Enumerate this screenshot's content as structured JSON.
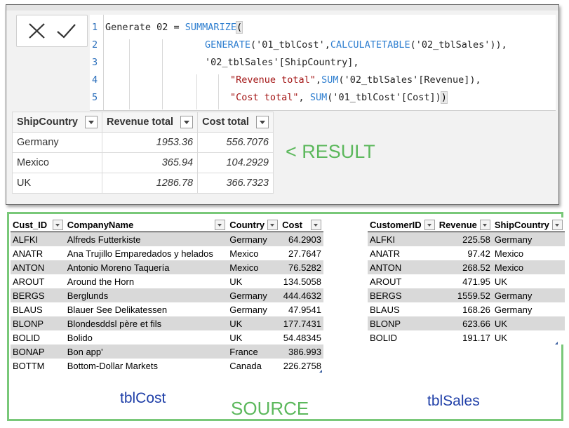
{
  "editor": {
    "cancel_icon": "close-icon",
    "commit_icon": "check-icon",
    "line_numbers": [
      "1",
      "2",
      "3",
      "4",
      "5"
    ],
    "code": [
      [
        {
          "t": "Generate 02 = ",
          "c": "txt"
        },
        {
          "t": "SUMMARIZE",
          "c": "kw"
        },
        {
          "t": "(",
          "c": "paren-hl"
        }
      ],
      [
        {
          "t": "GENERATE",
          "c": "kw"
        },
        {
          "t": "('01_tblCost',",
          "c": "txt"
        },
        {
          "t": "CALCULATETABLE",
          "c": "kw"
        },
        {
          "t": "('02_tblSales')),",
          "c": "txt"
        }
      ],
      [
        {
          "t": "'02_tblSales'[ShipCountry],",
          "c": "txt"
        }
      ],
      [
        {
          "t": "\"Revenue total\"",
          "c": "str"
        },
        {
          "t": ",",
          "c": "txt"
        },
        {
          "t": "SUM",
          "c": "kw"
        },
        {
          "t": "('02_tblSales'[Revenue]),",
          "c": "txt"
        }
      ],
      [
        {
          "t": "\"Cost total\"",
          "c": "str"
        },
        {
          "t": ", ",
          "c": "txt"
        },
        {
          "t": "SUM",
          "c": "kw"
        },
        {
          "t": "('01_tblCost'[Cost])",
          "c": "txt"
        },
        {
          "t": ")",
          "c": "paren-hl"
        }
      ]
    ]
  },
  "result": {
    "columns": [
      "ShipCountry",
      "Revenue total",
      "Cost total"
    ],
    "rows": [
      [
        "Germany",
        "1953.36",
        "556.7076"
      ],
      [
        "Mexico",
        "365.94",
        "104.2929"
      ],
      [
        "UK",
        "1286.78",
        "366.7323"
      ]
    ],
    "label": "< RESULT"
  },
  "tblCost": {
    "columns": [
      "Cust_ID",
      "CompanyName",
      "Country",
      "Cost"
    ],
    "rows": [
      [
        "ALFKI",
        "Alfreds Futterkiste",
        "Germany",
        "64.2903"
      ],
      [
        "ANATR",
        "Ana Trujillo Emparedados y helados",
        "Mexico",
        "27.7647"
      ],
      [
        "ANTON",
        "Antonio Moreno Taquería",
        "Mexico",
        "76.5282"
      ],
      [
        "AROUT",
        "Around the Horn",
        "UK",
        "134.5058"
      ],
      [
        "BERGS",
        "Berglunds",
        "Germany",
        "444.4632"
      ],
      [
        "BLAUS",
        "Blauer See Delikatessen",
        "Germany",
        "47.9541"
      ],
      [
        "BLONP",
        "Blondesddsl père et fils",
        "UK",
        "177.7431"
      ],
      [
        "BOLID",
        "Bolido",
        "UK",
        "54.48345"
      ],
      [
        "BONAP",
        "Bon app'",
        "France",
        "386.993"
      ],
      [
        "BOTTM",
        "Bottom-Dollar Markets",
        "Canada",
        "226.2758"
      ]
    ],
    "label": "tblCost"
  },
  "tblSales": {
    "columns": [
      "CustomerID",
      "Revenue",
      "ShipCountry"
    ],
    "rows": [
      [
        "ALFKI",
        "225.58",
        "Germany"
      ],
      [
        "ANATR",
        "97.42",
        "Mexico"
      ],
      [
        "ANTON",
        "268.52",
        "Mexico"
      ],
      [
        "AROUT",
        "471.95",
        "UK"
      ],
      [
        "BERGS",
        "1559.52",
        "Germany"
      ],
      [
        "BLAUS",
        "168.26",
        "Germany"
      ],
      [
        "BLONP",
        "623.66",
        "UK"
      ],
      [
        "BOLID",
        "191.17",
        "UK"
      ]
    ],
    "label": "tblSales"
  },
  "source_label": "SOURCE",
  "colors": {
    "keyword": "#2f7fd0",
    "string": "#a31515",
    "label_green": "#5cb85c",
    "table_label_blue": "#1f3fa8",
    "frame_green": "#79c879",
    "row_band": "#d9d9d9"
  }
}
